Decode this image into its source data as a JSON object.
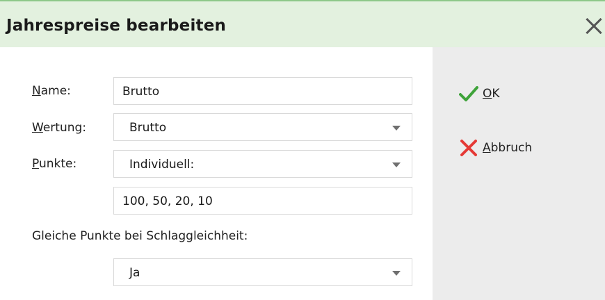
{
  "dialog": {
    "title": "Jahrespreise bearbeiten"
  },
  "form": {
    "name": {
      "label_mnemonic": "N",
      "label_rest": "ame:",
      "value": "Brutto"
    },
    "wertung": {
      "label_mnemonic": "W",
      "label_rest": "ertung:",
      "value": "Brutto"
    },
    "punkte": {
      "label_mnemonic": "P",
      "label_rest": "unkte:",
      "value": "Individuell:"
    },
    "points_values": "100, 50, 20, 10",
    "tie": {
      "label": "Gleiche Punkte bei Schlaggleichheit:",
      "value": "Ja"
    }
  },
  "actions": {
    "ok": {
      "mnemonic": "O",
      "rest": "K",
      "icon": "checkmark-icon",
      "color": "#3fa33a"
    },
    "cancel": {
      "mnemonic": "A",
      "rest": "bbruch",
      "icon": "cross-icon",
      "color": "#e53935"
    }
  }
}
